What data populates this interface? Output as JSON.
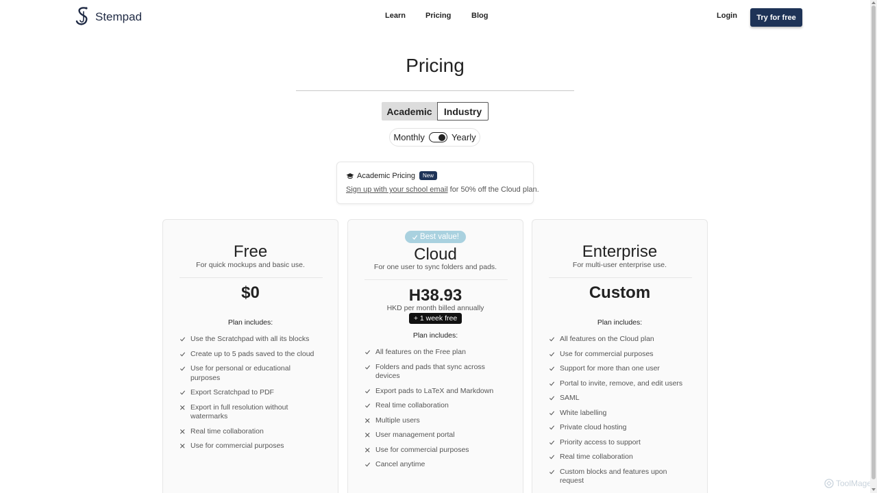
{
  "header": {
    "logo_text": "Stempad",
    "nav": [
      {
        "label": "Learn"
      },
      {
        "label": "Pricing"
      },
      {
        "label": "Blog"
      }
    ],
    "login_label": "Login",
    "cta_label": "Try for free"
  },
  "page": {
    "title": "Pricing",
    "segments": {
      "academic": "Academic",
      "industry": "Industry",
      "selected": "Academic"
    },
    "billing": {
      "monthly": "Monthly",
      "yearly": "Yearly",
      "selected": "Yearly"
    }
  },
  "promo": {
    "title": "Academic Pricing",
    "badge": "New",
    "link_text": "Sign up with your school email",
    "rest_text": " for 50% off the Cloud plan."
  },
  "plans": [
    {
      "name": "Free",
      "subtitle": "For quick mockups and basic use.",
      "price": "$0",
      "includes_label": "Plan includes:",
      "features": [
        {
          "text": "Use the Scratchpad with all its blocks",
          "included": true
        },
        {
          "text": "Create up to 5 pads saved to the cloud",
          "included": true
        },
        {
          "text": "Use for personal or educational purposes",
          "included": true
        },
        {
          "text": "Export Scratchpad to PDF",
          "included": true
        },
        {
          "text": "Export in full resolution without watermarks",
          "included": false
        },
        {
          "text": "Real time collaboration",
          "included": false
        },
        {
          "text": "Use for commercial purposes",
          "included": false
        }
      ]
    },
    {
      "name": "Cloud",
      "badge": "Best value!",
      "subtitle": "For one user to sync folders and pads.",
      "price": "H38.93",
      "price_note": "HKD per month billed annually",
      "trial_badge": "+ 1 week free",
      "includes_label": "Plan includes:",
      "features": [
        {
          "text": "All features on the Free plan",
          "included": true
        },
        {
          "text": "Folders and pads that sync across devices",
          "included": true
        },
        {
          "text": "Export pads to LaTeX and Markdown",
          "included": true
        },
        {
          "text": "Real time collaboration",
          "included": true
        },
        {
          "text": "Multiple users",
          "included": false
        },
        {
          "text": "User management portal",
          "included": false
        },
        {
          "text": "Use for commercial purposes",
          "included": false
        },
        {
          "text": "Cancel anytime",
          "included": true
        }
      ]
    },
    {
      "name": "Enterprise",
      "subtitle": "For multi-user enterprise use.",
      "price": "Custom",
      "includes_label": "Plan includes:",
      "features": [
        {
          "text": "All features on the Cloud plan",
          "included": true
        },
        {
          "text": "Use for commercial purposes",
          "included": true
        },
        {
          "text": "Support for more than one user",
          "included": true
        },
        {
          "text": "Portal to invite, remove, and edit users",
          "included": true
        },
        {
          "text": "SAML",
          "included": true
        },
        {
          "text": "White labelling",
          "included": true
        },
        {
          "text": "Private cloud hosting",
          "included": true
        },
        {
          "text": "Priority access to support",
          "included": true
        },
        {
          "text": "Real time collaboration",
          "included": true
        },
        {
          "text": "Custom blocks and features upon request",
          "included": true
        }
      ]
    }
  ],
  "watermark": "ToolMage",
  "colors": {
    "primary": "#1e3357",
    "best_value": "#a9d1df"
  }
}
